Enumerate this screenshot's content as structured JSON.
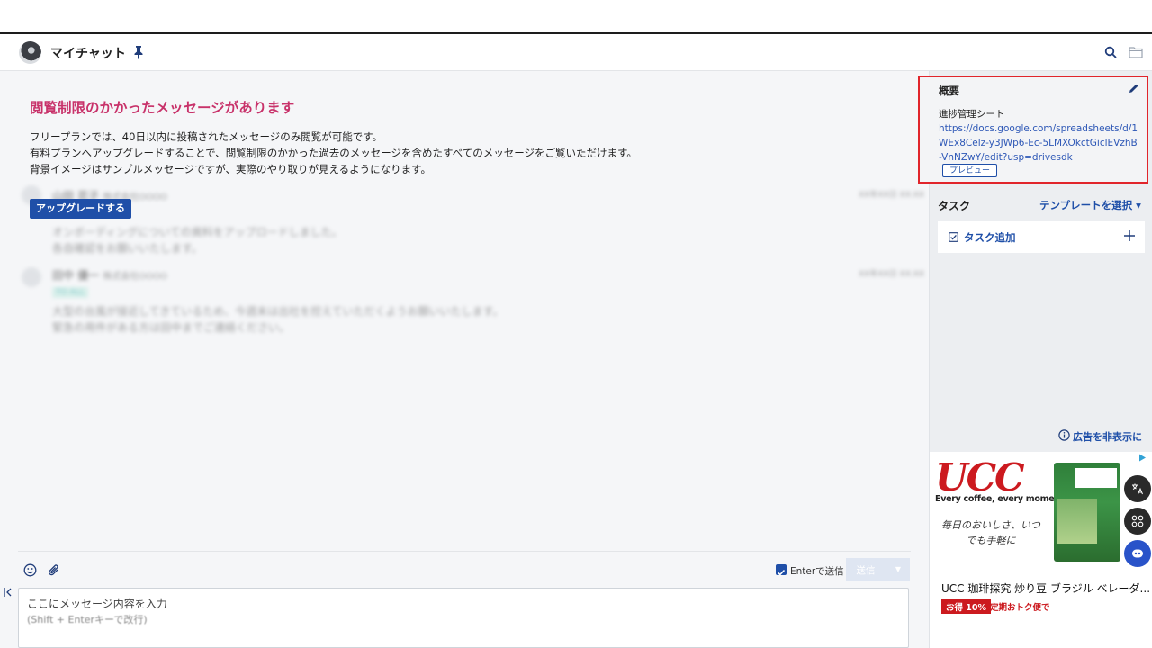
{
  "header": {
    "room_title": "マイチャット"
  },
  "main": {
    "restriction": {
      "title": "閲覧制限のかかったメッセージがあります",
      "line1": "フリープランでは、40日以内に投稿されたメッセージのみ閲覧が可能です。",
      "line2": "有料プランへアップグレードすることで、閲覧制限のかかった過去のメッセージを含めたすべてのメッセージをご覧いただけます。",
      "line3": "背景イメージはサンプルメッセージですが、実際のやり取りが見えるようになります。",
      "upgrade_label": "アップグレードする"
    },
    "sample_messages": [
      {
        "sender": "山田 花子",
        "company": "株式会社OOOO",
        "time": "XX年XX日 XX:XX",
        "lines": [
          "オンボーディングについての資料をアップロードしました。",
          "各自確認をお願いいたします。"
        ]
      },
      {
        "sender": "田中 優一",
        "company": "株式会社OOOO",
        "time": "XX年XX日 XX:XX",
        "chip": "TO ALL",
        "lines": [
          "大型の台風が接近してきているため、今週末は出社を控えていただくようお願いいたします。",
          "緊急の用件がある方は田中までご連絡ください。"
        ]
      }
    ]
  },
  "composer": {
    "enter_send_label": "Enterで送信",
    "send_label": "送信",
    "placeholder": "ここにメッセージ内容を入力",
    "hint": "(Shift + Enterキーで改行)"
  },
  "side": {
    "overview": {
      "heading": "概要",
      "sheet_name": "進捗管理シート",
      "link": "https://docs.google.com/spreadsheets/d/1WEx8Celz-y3JWp6-Ec-5LMXOkctGiclEVzhB-VnNZwY/edit?usp=drivesdk",
      "preview_label": "プレビュー"
    },
    "tasks": {
      "title": "タスク",
      "template_label": "テンプレートを選択 ▾",
      "add_label": "タスク追加"
    },
    "hide_ad_label": "広告を非表示に"
  },
  "ad": {
    "brand": "UCC",
    "slogan": "Every coffee, every moment",
    "copy": "毎日のおいしさ、いつでも手軽に",
    "title": "UCC 珈琲探究 炒り豆 ブラジル ベレーダ...",
    "badge": "お得 10%",
    "sub": "定期おトク便で"
  },
  "colors": {
    "accent": "#1f4fa8",
    "restriction_title": "#c8326a",
    "highlight_border": "#e1252b",
    "ad_red": "#cc1a1f"
  }
}
